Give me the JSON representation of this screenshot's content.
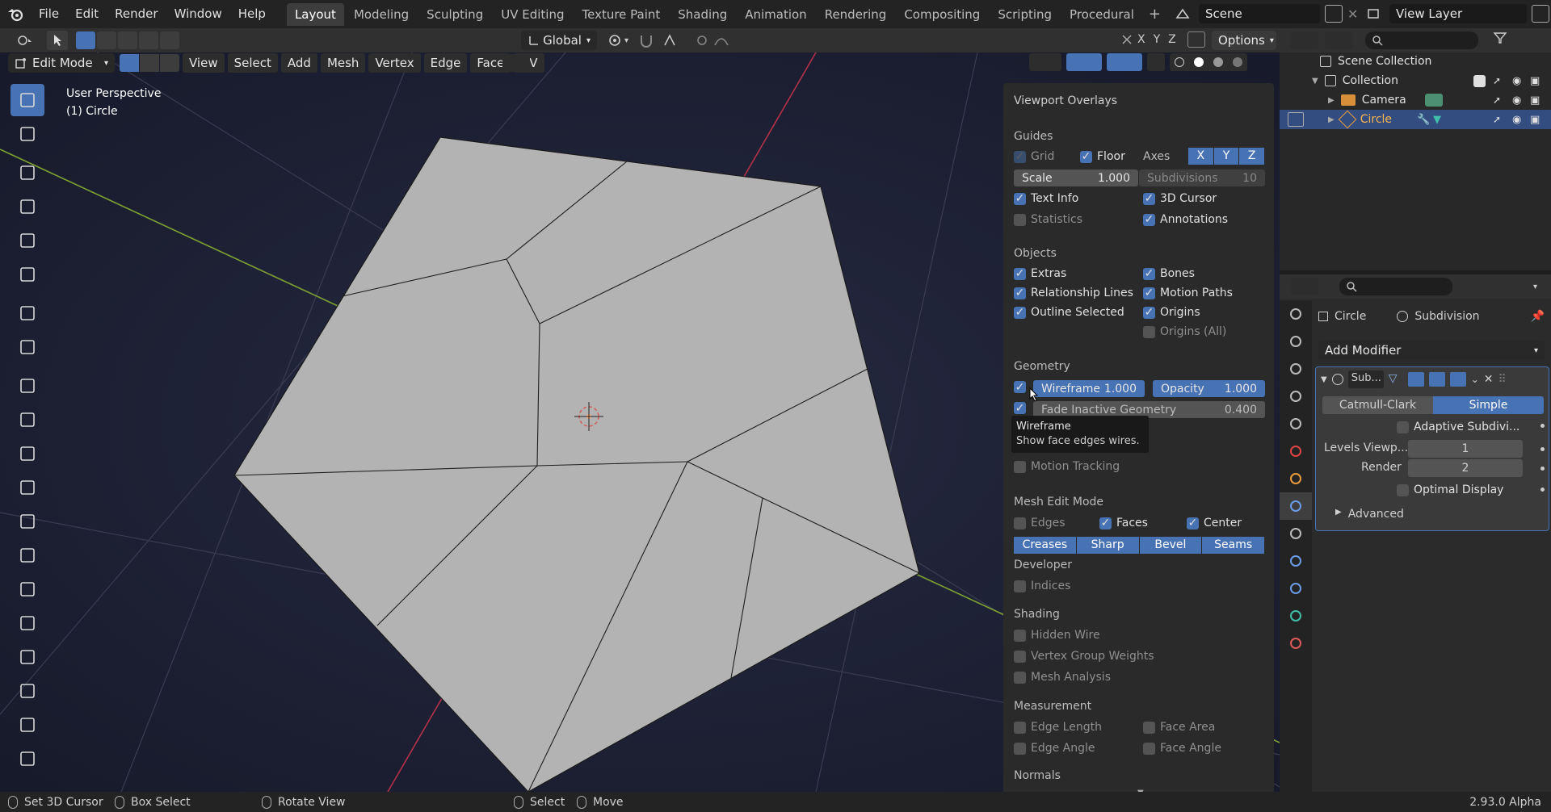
{
  "menu": {
    "file": "File",
    "edit": "Edit",
    "render": "Render",
    "window": "Window",
    "help": "Help"
  },
  "workspaces": [
    "Layout",
    "Modeling",
    "Sculpting",
    "UV Editing",
    "Texture Paint",
    "Shading",
    "Animation",
    "Rendering",
    "Compositing",
    "Scripting",
    "Procedural"
  ],
  "scene": "Scene",
  "view_layer": "View Layer",
  "toolbar_header": {
    "orientation": "Global",
    "options": "Options",
    "axes": [
      "X",
      "Y",
      "Z"
    ]
  },
  "edit_header": {
    "mode": "Edit Mode",
    "menus": [
      "View",
      "Select",
      "Add",
      "Mesh",
      "Vertex",
      "Edge",
      "Face",
      "UV"
    ]
  },
  "viewport": {
    "perspective": "User Perspective",
    "object": "(1) Circle",
    "colors": {
      "background": "#1c1f33",
      "face": "#b3b3b3",
      "x_axis": "#b3304a",
      "y_axis": "#7fa331"
    }
  },
  "overlays": {
    "title": "Viewport Overlays",
    "guides": {
      "label": "Guides",
      "grid": "Grid",
      "floor": "Floor",
      "axes": "Axes",
      "x": "X",
      "y": "Y",
      "z": "Z",
      "scale_label": "Scale",
      "scale_value": "1.000",
      "subdiv_label": "Subdivisions",
      "subdiv_value": "10",
      "text_info": "Text Info",
      "cursor": "3D Cursor",
      "statistics": "Statistics",
      "annotations": "Annotations"
    },
    "objects": {
      "label": "Objects",
      "extras": "Extras",
      "bones": "Bones",
      "rel_lines": "Relationship Lines",
      "motion_paths": "Motion Paths",
      "outline": "Outline Selected",
      "origins": "Origins",
      "origins_all": "Origins (All)"
    },
    "geometry": {
      "label": "Geometry",
      "wireframe_label": "Wireframe",
      "wireframe_value": "1.000",
      "opacity_label": "Opacity",
      "opacity_value": "1.000",
      "fade_label": "Fade Inactive Geometry",
      "fade_value": "0.400",
      "motion_tracking": "Motion Tracking"
    },
    "tooltip": {
      "title": "Wireframe",
      "desc": "Show face edges wires."
    },
    "mesh_edit": {
      "label": "Mesh Edit Mode",
      "edges": "Edges",
      "faces": "Faces",
      "center": "Center",
      "creases": "Creases",
      "sharp": "Sharp",
      "bevel": "Bevel",
      "seams": "Seams"
    },
    "developer": {
      "label": "Developer",
      "indices": "Indices"
    },
    "shading": {
      "label": "Shading",
      "hidden_wire": "Hidden Wire",
      "vgroup": "Vertex Group Weights",
      "mesh_analysis": "Mesh Analysis"
    },
    "measurement": {
      "label": "Measurement",
      "edge_length": "Edge Length",
      "face_area": "Face Area",
      "edge_angle": "Edge Angle",
      "face_angle": "Face Angle"
    },
    "normals": {
      "label": "Normals"
    }
  },
  "outliner": {
    "scene_collection": "Scene Collection",
    "collection": "Collection",
    "camera": "Camera",
    "circle": "Circle"
  },
  "properties": {
    "object": "Circle",
    "modifier": "Subdivision",
    "add_modifier": "Add Modifier",
    "mod_short": "Sub...",
    "catmull": "Catmull-Clark",
    "simple": "Simple",
    "adaptive": "Adaptive Subdivi...",
    "levels_label": "Levels Viewp...",
    "levels_value": "1",
    "render_label": "Render",
    "render_value": "2",
    "optimal": "Optimal Display",
    "advanced": "Advanced"
  },
  "status": {
    "set_cursor": "Set 3D Cursor",
    "box_select": "Box Select",
    "rotate": "Rotate View",
    "select": "Select",
    "move": "Move",
    "version": "2.93.0 Alpha"
  }
}
